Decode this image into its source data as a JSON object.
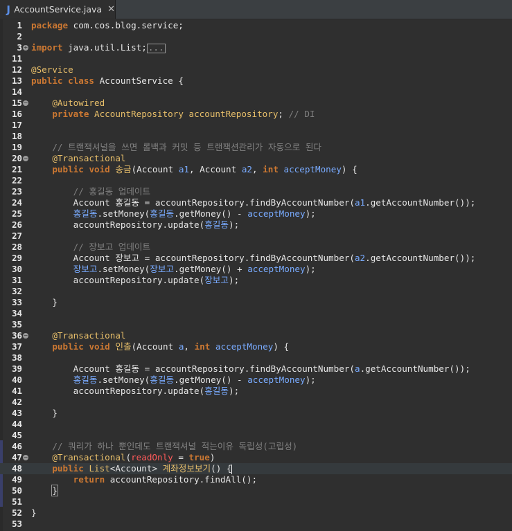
{
  "tab": {
    "icon": "java-file-icon",
    "icon_glyph": "J",
    "file_name": "AccountService.java",
    "close_glyph": "✕"
  },
  "colors": {
    "keyword": "#cc7832",
    "annotation": "#e8bf6a",
    "field": "#66b0e5",
    "comment": "#808080",
    "local_variable": "#79abff",
    "background": "#2f2f2f"
  },
  "current_line": 48,
  "lines": [
    {
      "n": "1",
      "tokens": [
        [
          "kw",
          "package"
        ],
        [
          "plain",
          " com.cos.blog.service;"
        ]
      ]
    },
    {
      "n": "2",
      "tokens": []
    },
    {
      "n": "3",
      "fold": "plus",
      "tokens": [
        [
          "kw",
          "import"
        ],
        [
          "plain",
          " java.util.List;"
        ],
        [
          "box",
          "..."
        ]
      ]
    },
    {
      "n": "11",
      "tokens": []
    },
    {
      "n": "12",
      "tokens": [
        [
          "ann",
          "@Service"
        ]
      ]
    },
    {
      "n": "13",
      "tokens": [
        [
          "kw",
          "public"
        ],
        [
          "plain",
          " "
        ],
        [
          "kw",
          "class"
        ],
        [
          "plain",
          " AccountService {"
        ]
      ]
    },
    {
      "n": "14",
      "tokens": []
    },
    {
      "n": "15",
      "fold": "minus",
      "tokens": [
        [
          "plain",
          "    "
        ],
        [
          "ann",
          "@Autowired"
        ]
      ]
    },
    {
      "n": "16",
      "tokens": [
        [
          "plain",
          "    "
        ],
        [
          "kw",
          "private"
        ],
        [
          "plain",
          " "
        ],
        [
          "ann",
          "AccountRepository"
        ],
        [
          "plain",
          " "
        ],
        [
          "ann",
          "accountRepository"
        ],
        [
          "plain",
          "; "
        ],
        [
          "cmt",
          "// DI"
        ]
      ]
    },
    {
      "n": "17",
      "tokens": []
    },
    {
      "n": "18",
      "tokens": []
    },
    {
      "n": "19",
      "tokens": [
        [
          "plain",
          "    "
        ],
        [
          "cmt",
          "// 트랜잭셔널을 쓰면 롤백과 커밋 등 트랜잭션관리가 자동으로 된다"
        ]
      ]
    },
    {
      "n": "20",
      "fold": "minus",
      "tokens": [
        [
          "plain",
          "    "
        ],
        [
          "ann",
          "@Transactional"
        ]
      ]
    },
    {
      "n": "21",
      "tokens": [
        [
          "plain",
          "    "
        ],
        [
          "kw",
          "public"
        ],
        [
          "plain",
          " "
        ],
        [
          "kw",
          "void"
        ],
        [
          "plain",
          " "
        ],
        [
          "ann",
          "송금"
        ],
        [
          "plain",
          "(Account "
        ],
        [
          "loc",
          "a1"
        ],
        [
          "plain",
          ", Account "
        ],
        [
          "loc",
          "a2"
        ],
        [
          "plain",
          ", "
        ],
        [
          "kw",
          "int"
        ],
        [
          "plain",
          " "
        ],
        [
          "loc",
          "acceptMoney"
        ],
        [
          "plain",
          ") {"
        ]
      ]
    },
    {
      "n": "22",
      "tokens": []
    },
    {
      "n": "23",
      "tokens": [
        [
          "plain",
          "        "
        ],
        [
          "cmt",
          "// 홍길동 업데이트"
        ]
      ]
    },
    {
      "n": "24",
      "tokens": [
        [
          "plain",
          "        Account "
        ],
        [
          "typ",
          "홍길동"
        ],
        [
          "plain",
          " = accountRepository.findByAccountNumber("
        ],
        [
          "loc",
          "a1"
        ],
        [
          "plain",
          ".getAccountNumber());"
        ]
      ]
    },
    {
      "n": "25",
      "tokens": [
        [
          "plain",
          "        "
        ],
        [
          "loc",
          "홍길동"
        ],
        [
          "plain",
          ".setMoney("
        ],
        [
          "loc",
          "홍길동"
        ],
        [
          "plain",
          ".getMoney() - "
        ],
        [
          "loc",
          "acceptMoney"
        ],
        [
          "plain",
          ");"
        ]
      ]
    },
    {
      "n": "26",
      "tokens": [
        [
          "plain",
          "        accountRepository.update("
        ],
        [
          "loc",
          "홍길동"
        ],
        [
          "plain",
          ");"
        ]
      ]
    },
    {
      "n": "27",
      "tokens": []
    },
    {
      "n": "28",
      "tokens": [
        [
          "plain",
          "        "
        ],
        [
          "cmt",
          "// 장보고 업데이트"
        ]
      ]
    },
    {
      "n": "29",
      "tokens": [
        [
          "plain",
          "        Account "
        ],
        [
          "typ",
          "장보고"
        ],
        [
          "plain",
          " = accountRepository.findByAccountNumber("
        ],
        [
          "loc",
          "a2"
        ],
        [
          "plain",
          ".getAccountNumber());"
        ]
      ]
    },
    {
      "n": "30",
      "tokens": [
        [
          "plain",
          "        "
        ],
        [
          "loc",
          "장보고"
        ],
        [
          "plain",
          ".setMoney("
        ],
        [
          "loc",
          "장보고"
        ],
        [
          "plain",
          ".getMoney() + "
        ],
        [
          "loc",
          "acceptMoney"
        ],
        [
          "plain",
          ");"
        ]
      ]
    },
    {
      "n": "31",
      "tokens": [
        [
          "plain",
          "        accountRepository.update("
        ],
        [
          "loc",
          "장보고"
        ],
        [
          "plain",
          ");"
        ]
      ]
    },
    {
      "n": "32",
      "tokens": []
    },
    {
      "n": "33",
      "tokens": [
        [
          "plain",
          "    }"
        ]
      ]
    },
    {
      "n": "34",
      "tokens": []
    },
    {
      "n": "35",
      "tokens": []
    },
    {
      "n": "36",
      "fold": "minus",
      "tokens": [
        [
          "plain",
          "    "
        ],
        [
          "ann",
          "@Transactional"
        ]
      ]
    },
    {
      "n": "37",
      "tokens": [
        [
          "plain",
          "    "
        ],
        [
          "kw",
          "public"
        ],
        [
          "plain",
          " "
        ],
        [
          "kw",
          "void"
        ],
        [
          "plain",
          " "
        ],
        [
          "ann",
          "인출"
        ],
        [
          "plain",
          "(Account "
        ],
        [
          "loc",
          "a"
        ],
        [
          "plain",
          ", "
        ],
        [
          "kw",
          "int"
        ],
        [
          "plain",
          " "
        ],
        [
          "loc",
          "acceptMoney"
        ],
        [
          "plain",
          ") {"
        ]
      ]
    },
    {
      "n": "38",
      "tokens": []
    },
    {
      "n": "39",
      "tokens": [
        [
          "plain",
          "        Account "
        ],
        [
          "typ",
          "홍길동"
        ],
        [
          "plain",
          " = accountRepository.findByAccountNumber("
        ],
        [
          "loc",
          "a"
        ],
        [
          "plain",
          ".getAccountNumber());"
        ]
      ]
    },
    {
      "n": "40",
      "tokens": [
        [
          "plain",
          "        "
        ],
        [
          "loc",
          "홍길동"
        ],
        [
          "plain",
          ".setMoney("
        ],
        [
          "loc",
          "홍길동"
        ],
        [
          "plain",
          ".getMoney() - "
        ],
        [
          "loc",
          "acceptMoney"
        ],
        [
          "plain",
          ");"
        ]
      ]
    },
    {
      "n": "41",
      "tokens": [
        [
          "plain",
          "        accountRepository.update("
        ],
        [
          "loc",
          "홍길동"
        ],
        [
          "plain",
          ");"
        ]
      ]
    },
    {
      "n": "42",
      "tokens": []
    },
    {
      "n": "43",
      "tokens": [
        [
          "plain",
          "    }"
        ]
      ]
    },
    {
      "n": "44",
      "tokens": []
    },
    {
      "n": "45",
      "tokens": []
    },
    {
      "n": "46",
      "tokens": [
        [
          "plain",
          "    "
        ],
        [
          "cmt",
          "// 쿼리가 하나 뿐인데도 트랜잭셔널 적는이유 독립성(고립성)"
        ]
      ]
    },
    {
      "n": "47",
      "fold": "minus",
      "tokens": [
        [
          "plain",
          "    "
        ],
        [
          "ann",
          "@Transactional"
        ],
        [
          "plain",
          "("
        ],
        [
          "param",
          "readOnly"
        ],
        [
          "plain",
          " = "
        ],
        [
          "lit",
          "true"
        ],
        [
          "plain",
          ")"
        ]
      ]
    },
    {
      "n": "48",
      "tokens": [
        [
          "plain",
          "    "
        ],
        [
          "kw",
          "public"
        ],
        [
          "plain",
          " "
        ],
        [
          "ann",
          "List"
        ],
        [
          "plain",
          "<Account> "
        ],
        [
          "ann",
          "계좌정보보기"
        ],
        [
          "plain",
          "() {"
        ],
        [
          "caret",
          ""
        ]
      ]
    },
    {
      "n": "49",
      "tokens": [
        [
          "plain",
          "        "
        ],
        [
          "kw",
          "return"
        ],
        [
          "plain",
          " accountRepository.findAll();"
        ]
      ]
    },
    {
      "n": "50",
      "tokens": [
        [
          "plain",
          "    "
        ],
        [
          "bracket",
          "}"
        ]
      ]
    },
    {
      "n": "51",
      "tokens": []
    },
    {
      "n": "52",
      "tokens": [
        [
          "plain",
          "}"
        ]
      ]
    },
    {
      "n": "53",
      "tokens": []
    }
  ]
}
